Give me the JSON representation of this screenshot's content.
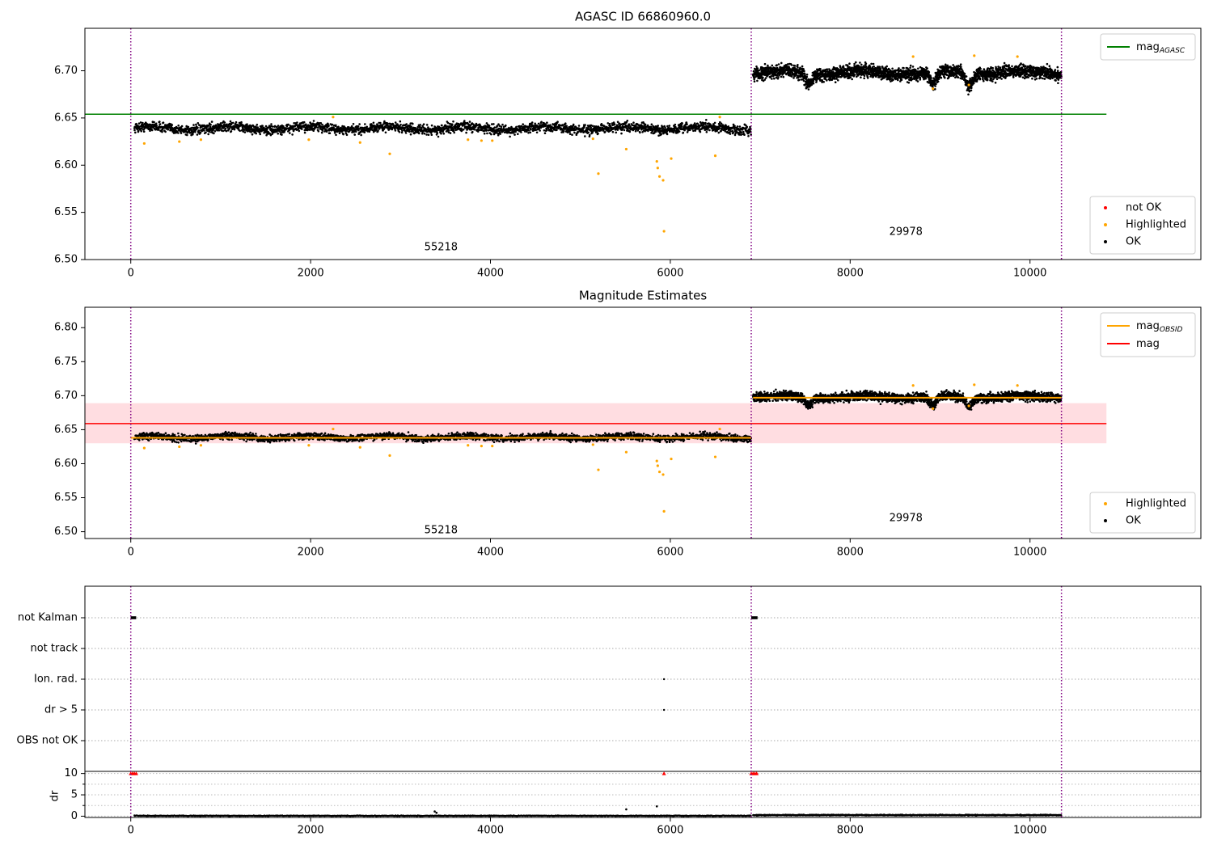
{
  "chart_data": [
    {
      "type": "scatter",
      "title": "AGASC ID 66860960.0",
      "xlim": [
        -510,
        11900
      ],
      "ylim": [
        6.5,
        6.745
      ],
      "xticks": [
        0,
        2000,
        4000,
        6000,
        8000,
        10000
      ],
      "yticks": [
        6.5,
        6.55,
        6.6,
        6.65,
        6.7
      ],
      "ytick_labels": [
        "6.50",
        "6.55",
        "6.60",
        "6.65",
        "6.70"
      ],
      "vlines": [
        0,
        6900,
        10350
      ],
      "hlines": [
        {
          "y": 6.654,
          "x0": -510,
          "x1": 10850,
          "color": "#008000",
          "name": "mag",
          "sub": "AGASC"
        }
      ],
      "segments": [
        {
          "x0": 40,
          "x1": 6900,
          "mean": 6.639,
          "spread": 0.009
        },
        {
          "x0": 6920,
          "x1": 10350,
          "mean": 6.698,
          "spread": 0.012,
          "dips": [
            [
              7540,
              -0.012
            ],
            [
              8920,
              -0.014
            ],
            [
              9320,
              -0.013
            ]
          ]
        }
      ],
      "highlighted": [
        [
          150,
          6.623
        ],
        [
          540,
          6.625
        ],
        [
          780,
          6.627
        ],
        [
          1980,
          6.627
        ],
        [
          2250,
          6.651
        ],
        [
          2550,
          6.624
        ],
        [
          2880,
          6.612
        ],
        [
          3750,
          6.627
        ],
        [
          3900,
          6.626
        ],
        [
          4020,
          6.626
        ],
        [
          5140,
          6.628
        ],
        [
          5200,
          6.591
        ],
        [
          5510,
          6.617
        ],
        [
          5850,
          6.604
        ],
        [
          5860,
          6.597
        ],
        [
          5880,
          6.588
        ],
        [
          5920,
          6.584
        ],
        [
          5930,
          6.53
        ],
        [
          6010,
          6.607
        ],
        [
          6500,
          6.61
        ],
        [
          6550,
          6.651
        ],
        [
          8700,
          6.715
        ],
        [
          8920,
          6.681
        ],
        [
          9320,
          6.685
        ],
        [
          9380,
          6.716
        ],
        [
          9860,
          6.715
        ]
      ],
      "segment_counts": [
        {
          "x": 3450,
          "y": 6.513,
          "label": "55218"
        },
        {
          "x": 8620,
          "y": 6.529,
          "label": "29978"
        }
      ],
      "legend_lines": [
        {
          "label": "mag",
          "sub": "AGASC",
          "color": "#008000"
        }
      ],
      "legend_markers": [
        {
          "label": "not OK",
          "color": "#ff0000"
        },
        {
          "label": "Highlighted",
          "color": "#ffa500"
        },
        {
          "label": "OK",
          "color": "#000000"
        }
      ]
    },
    {
      "type": "scatter",
      "title": "Magnitude Estimates",
      "xlim": [
        -510,
        11900
      ],
      "ylim": [
        6.49,
        6.83
      ],
      "xticks": [
        0,
        2000,
        4000,
        6000,
        8000,
        10000
      ],
      "yticks": [
        6.5,
        6.55,
        6.6,
        6.65,
        6.7,
        6.75,
        6.8
      ],
      "ytick_labels": [
        "6.50",
        "6.55",
        "6.60",
        "6.65",
        "6.70",
        "6.75",
        "6.80"
      ],
      "vlines": [
        0,
        6900,
        10350
      ],
      "band": {
        "x0": -510,
        "x1": 10850,
        "y0": 6.63,
        "y1": 6.689,
        "color": "#ffdde1"
      },
      "hlines": [
        {
          "y": 6.659,
          "x0": -510,
          "x1": 10850,
          "color": "#ff0000",
          "name": "mag"
        }
      ],
      "obsid_lines": [
        {
          "x0": 0,
          "x1": 6900,
          "y": 6.638
        },
        {
          "x0": 6920,
          "x1": 10350,
          "y": 6.697
        }
      ],
      "segments": [
        {
          "x0": 40,
          "x1": 6900,
          "mean": 6.639,
          "spread": 0.009
        },
        {
          "x0": 6920,
          "x1": 10350,
          "mean": 6.698,
          "spread": 0.012,
          "dips": [
            [
              7540,
              -0.012
            ],
            [
              8920,
              -0.014
            ],
            [
              9320,
              -0.013
            ]
          ]
        }
      ],
      "highlighted": [
        [
          150,
          6.623
        ],
        [
          540,
          6.625
        ],
        [
          780,
          6.627
        ],
        [
          1980,
          6.627
        ],
        [
          2250,
          6.651
        ],
        [
          2550,
          6.624
        ],
        [
          2880,
          6.612
        ],
        [
          3750,
          6.627
        ],
        [
          3900,
          6.626
        ],
        [
          4020,
          6.626
        ],
        [
          5140,
          6.628
        ],
        [
          5200,
          6.591
        ],
        [
          5510,
          6.617
        ],
        [
          5850,
          6.604
        ],
        [
          5860,
          6.597
        ],
        [
          5880,
          6.588
        ],
        [
          5920,
          6.584
        ],
        [
          5930,
          6.53
        ],
        [
          6010,
          6.607
        ],
        [
          6500,
          6.61
        ],
        [
          6550,
          6.651
        ],
        [
          8700,
          6.715
        ],
        [
          8920,
          6.681
        ],
        [
          9320,
          6.685
        ],
        [
          9380,
          6.716
        ],
        [
          9860,
          6.715
        ]
      ],
      "segment_counts": [
        {
          "x": 3450,
          "y": 6.502,
          "label": "55218"
        },
        {
          "x": 8620,
          "y": 6.52,
          "label": "29978"
        }
      ],
      "legend_lines": [
        {
          "label": "mag",
          "sub": "OBSID",
          "color": "#ffa500"
        },
        {
          "label": "mag",
          "color": "#ff0000"
        }
      ],
      "legend_markers": [
        {
          "label": "Highlighted",
          "color": "#ffa500"
        },
        {
          "label": "OK",
          "color": "#000000"
        }
      ]
    },
    {
      "type": "scatter",
      "title": "",
      "xlim": [
        -510,
        11900
      ],
      "vlines": [
        0,
        6900,
        10350
      ],
      "flag_rows": [
        "not Kalman",
        "not track",
        "Ion. rad.",
        "dr > 5",
        "OBS not OK"
      ],
      "flag_points": [
        {
          "row": "not Kalman",
          "x0": 0,
          "x1": 60
        },
        {
          "row": "not Kalman",
          "x0": 6900,
          "x1": 6970
        },
        {
          "row": "Ion. rad.",
          "x0": 5930,
          "x1": 5930
        },
        {
          "row": "dr > 5",
          "x0": 5930,
          "x1": 5930
        }
      ],
      "ylabel": "dr",
      "ylim": [
        -0.3,
        10.5
      ],
      "yticks": [
        0,
        5,
        10
      ],
      "ytick_labels": [
        "0",
        "5",
        "10"
      ],
      "dr_clipped": [
        [
          0,
          10
        ],
        [
          20,
          10
        ],
        [
          40,
          10
        ],
        [
          60,
          10
        ],
        [
          5930,
          10
        ],
        [
          6900,
          10
        ],
        [
          6920,
          10
        ],
        [
          6940,
          10
        ],
        [
          6960,
          10
        ]
      ],
      "dr_outliers": [
        [
          3380,
          1.1
        ],
        [
          3400,
          0.8
        ],
        [
          5510,
          1.6
        ],
        [
          5850,
          2.3
        ]
      ],
      "dr_segments": [
        {
          "x0": 40,
          "x1": 6900,
          "mean": 0.1,
          "spread": 0.15
        },
        {
          "x0": 6920,
          "x1": 10350,
          "mean": 0.25,
          "spread": 0.2
        }
      ]
    }
  ]
}
